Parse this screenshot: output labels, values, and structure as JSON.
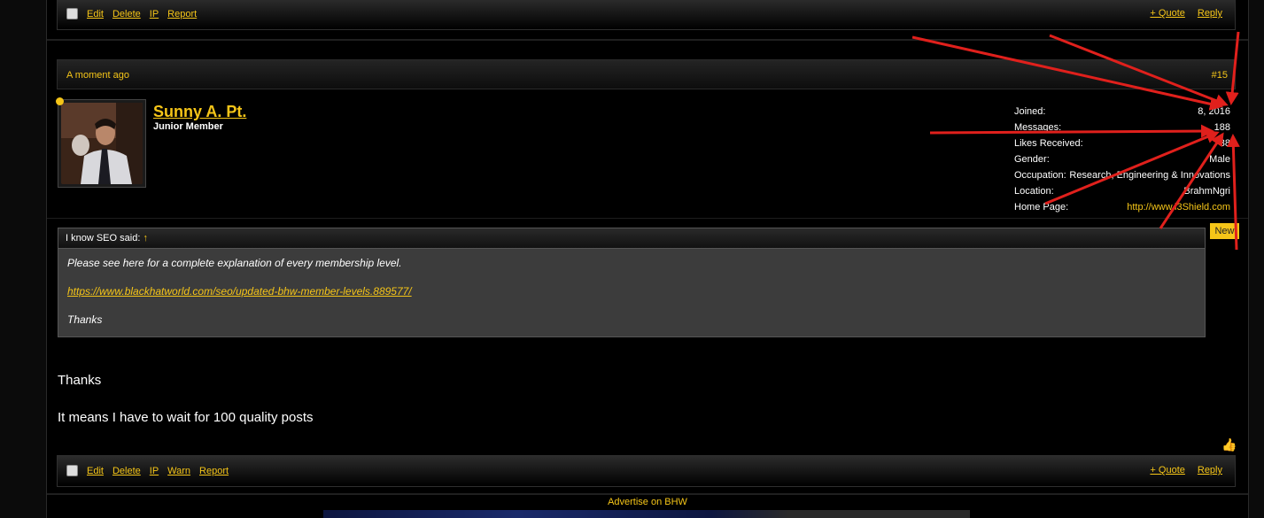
{
  "top_bar": {
    "edit": "Edit",
    "delete": "Delete",
    "ip": "IP",
    "report": "Report",
    "quote": "+ Quote",
    "reply": "Reply"
  },
  "post": {
    "timestamp": "A moment ago",
    "number": "#15",
    "username": "Sunny A. Pt.",
    "user_title": "Junior Member",
    "info": [
      {
        "key": "Joined:",
        "value": "8, 2016"
      },
      {
        "key": "Messages:",
        "value": "188"
      },
      {
        "key": "Likes Received:",
        "value": "38"
      },
      {
        "key": "Gender:",
        "value": "Male"
      },
      {
        "key": "Occupation:",
        "value": "Research, Engineering & Innovations"
      },
      {
        "key": "Location:",
        "value": "BrahmNgri"
      },
      {
        "key": "Home Page:",
        "value": "http://www.i3Shield.com"
      }
    ],
    "quote": {
      "author": "I know SEO said:",
      "jump": "↑",
      "line1": "Please see here for a complete explanation of every membership level.",
      "link": "https://www.blackhatworld.com/seo/updated-bhw-member-levels.889577/",
      "line3": "Thanks"
    },
    "new_badge": "New",
    "message_line1": "Thanks",
    "message_line2": "It means I have to wait for 100 quality posts"
  },
  "bottom_bar": {
    "edit": "Edit",
    "delete": "Delete",
    "ip": "IP",
    "warn": "Warn",
    "report": "Report",
    "quote": "+ Quote",
    "reply": "Reply"
  },
  "advertise": "Advertise on BHW",
  "colors": {
    "accent": "#f5c518",
    "arrow": "#e0201c"
  }
}
